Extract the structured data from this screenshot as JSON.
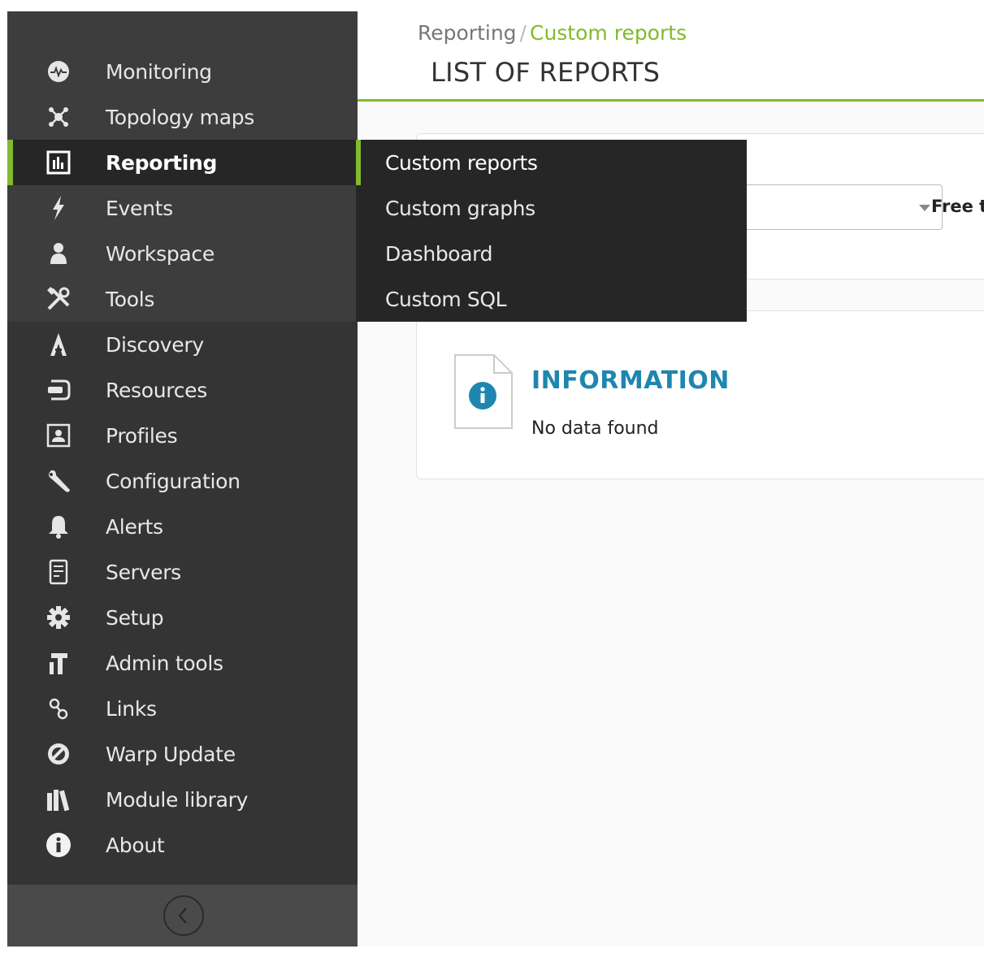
{
  "sidebar": {
    "items": [
      {
        "label": "Monitoring",
        "icon": "monitoring-icon"
      },
      {
        "label": "Topology maps",
        "icon": "topology-icon"
      },
      {
        "label": "Reporting",
        "icon": "reporting-icon",
        "active": true
      },
      {
        "label": "Events",
        "icon": "lightning-icon"
      },
      {
        "label": "Workspace",
        "icon": "user-icon"
      },
      {
        "label": "Tools",
        "icon": "tools-icon"
      },
      {
        "label": "Discovery",
        "icon": "discovery-icon"
      },
      {
        "label": "Resources",
        "icon": "resources-icon"
      },
      {
        "label": "Profiles",
        "icon": "profile-icon"
      },
      {
        "label": "Configuration",
        "icon": "wrench-icon"
      },
      {
        "label": "Alerts",
        "icon": "bell-icon"
      },
      {
        "label": "Servers",
        "icon": "server-icon"
      },
      {
        "label": "Setup",
        "icon": "gear-icon"
      },
      {
        "label": "Admin tools",
        "icon": "admin-tools-icon"
      },
      {
        "label": "Links",
        "icon": "links-icon"
      },
      {
        "label": "Warp Update",
        "icon": "warp-update-icon"
      },
      {
        "label": "Module library",
        "icon": "library-icon"
      },
      {
        "label": "About",
        "icon": "info-icon"
      }
    ]
  },
  "submenu": {
    "items": [
      {
        "label": "Custom reports",
        "active": true
      },
      {
        "label": "Custom graphs"
      },
      {
        "label": "Dashboard"
      },
      {
        "label": "Custom SQL"
      }
    ]
  },
  "header": {
    "breadcrumb": {
      "parent": "Reporting",
      "separator": "/",
      "current": "Custom reports"
    },
    "title": "LIST OF REPORTS"
  },
  "filter": {
    "free_text_label": "Free te"
  },
  "info": {
    "title": "INFORMATION",
    "message": "No data found"
  },
  "colors": {
    "accent": "#82b92e",
    "info_title": "#1f86b0",
    "sidebar_bg": "#343434"
  }
}
